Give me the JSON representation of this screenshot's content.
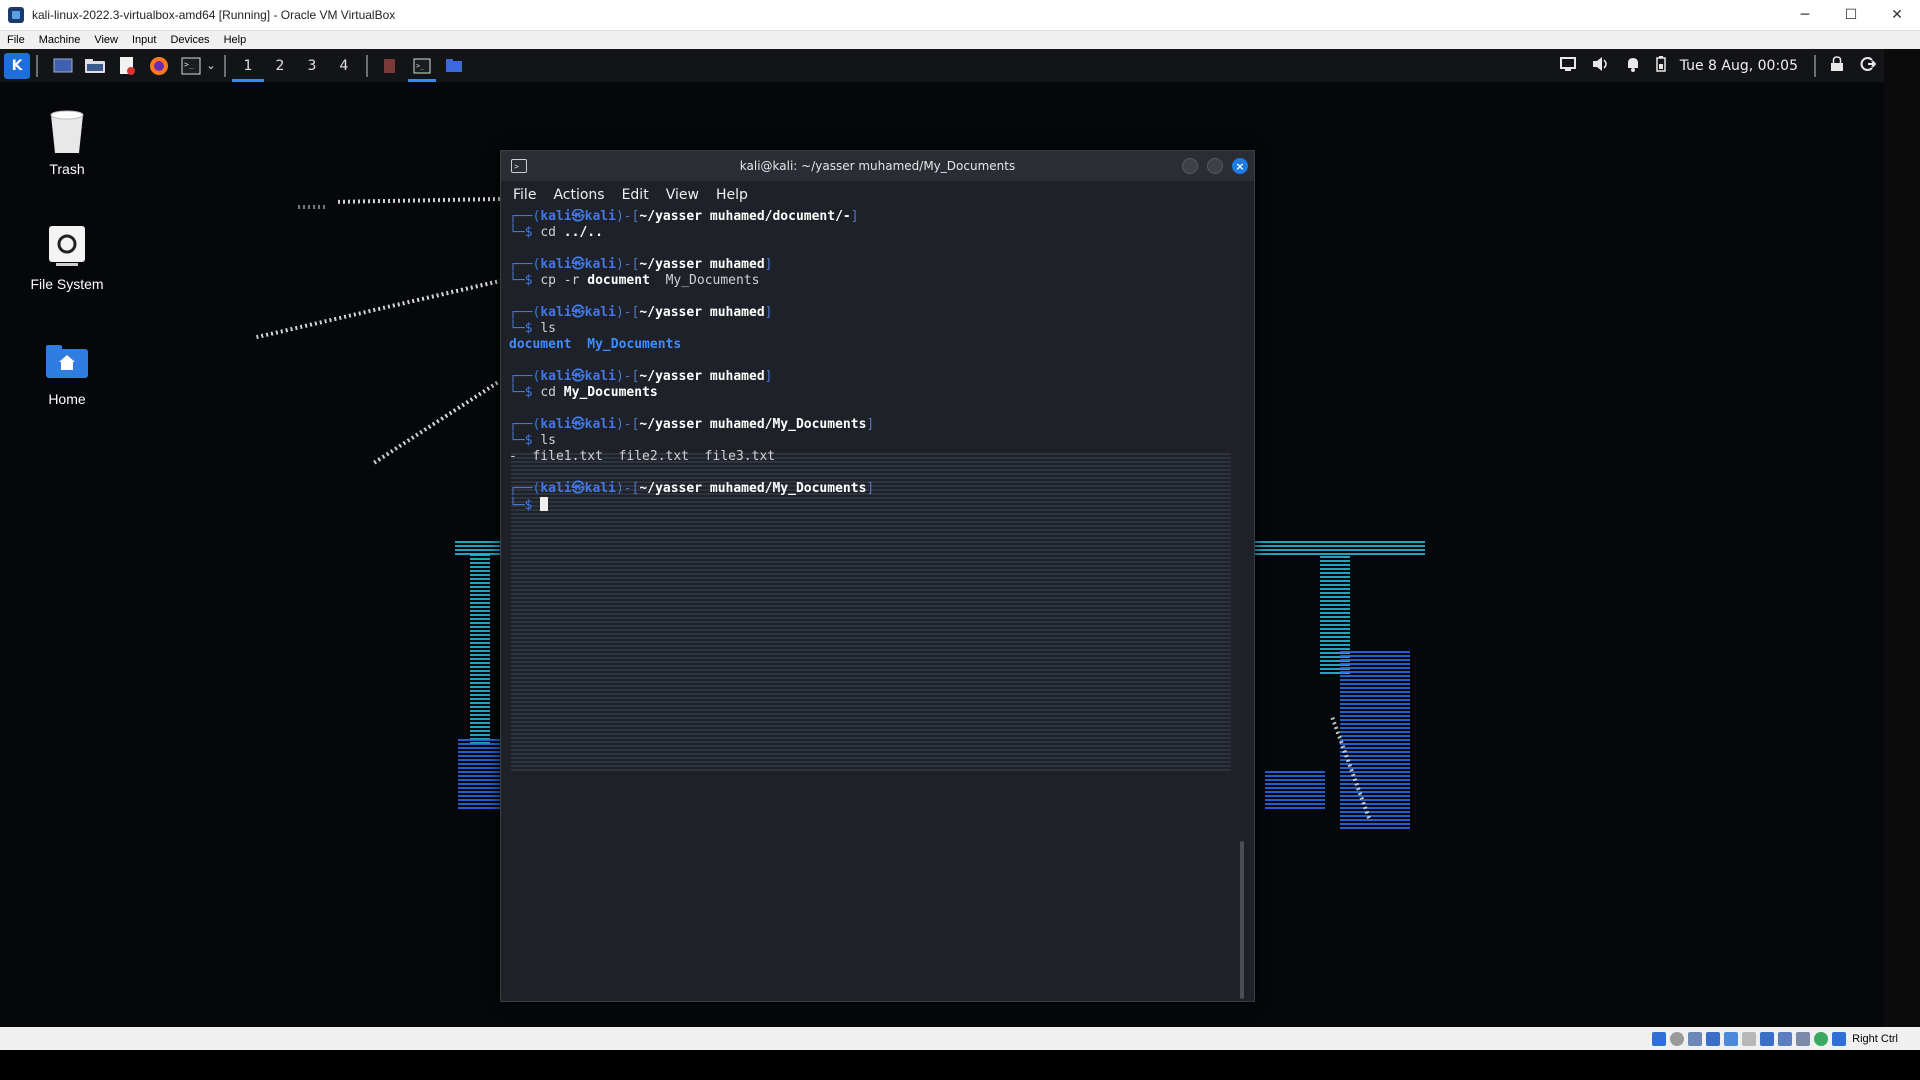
{
  "vbox": {
    "title": "kali-linux-2022.3-virtualbox-amd64 [Running] - Oracle VM VirtualBox",
    "minimize_glyph": "─",
    "maximize_glyph": "☐",
    "close_glyph": "✕",
    "menu": [
      "File",
      "Machine",
      "View",
      "Input",
      "Devices",
      "Help"
    ],
    "hostkey_label": "Right Ctrl"
  },
  "panel": {
    "workspaces": [
      "1",
      "2",
      "3",
      "4"
    ],
    "active_workspace": "1",
    "clock": "Tue 8 Aug, 00:05"
  },
  "desktop": {
    "icons": [
      {
        "label": "Trash",
        "icon": "trash-icon"
      },
      {
        "label": "File System",
        "icon": "filesystem-icon"
      },
      {
        "label": "Home",
        "icon": "home-folder-icon"
      }
    ]
  },
  "terminal": {
    "title": "kali@kali: ~/yasser muhamed/My_Documents",
    "menu": [
      "File",
      "Actions",
      "Edit",
      "View",
      "Help"
    ],
    "user_host": "kali㉿kali",
    "blocks": [
      {
        "path": "~/yasser muhamed/document/-",
        "cmd": "cd",
        "args": "../..",
        "output": ""
      },
      {
        "path": "~/yasser muhamed",
        "cmd": "cp -r",
        "args": "document  My_Documents",
        "output": ""
      },
      {
        "path": "~/yasser muhamed",
        "cmd": "ls",
        "args": "",
        "output": "document  My_Documents"
      },
      {
        "path": "~/yasser muhamed",
        "cmd": "cd",
        "args": "My_Documents",
        "output": ""
      },
      {
        "path": "~/yasser muhamed/My_Documents",
        "cmd": "ls",
        "args": "",
        "output": "-  file1.txt  file2.txt  file3.txt"
      },
      {
        "path": "~/yasser muhamed/My_Documents",
        "cmd": "",
        "args": "",
        "output": ""
      }
    ]
  },
  "colors": {
    "accent": "#3a86ff",
    "prompt_blue": "#3f78e8",
    "terminal_bg": "#1e2128",
    "panel_bg": "#121418"
  }
}
